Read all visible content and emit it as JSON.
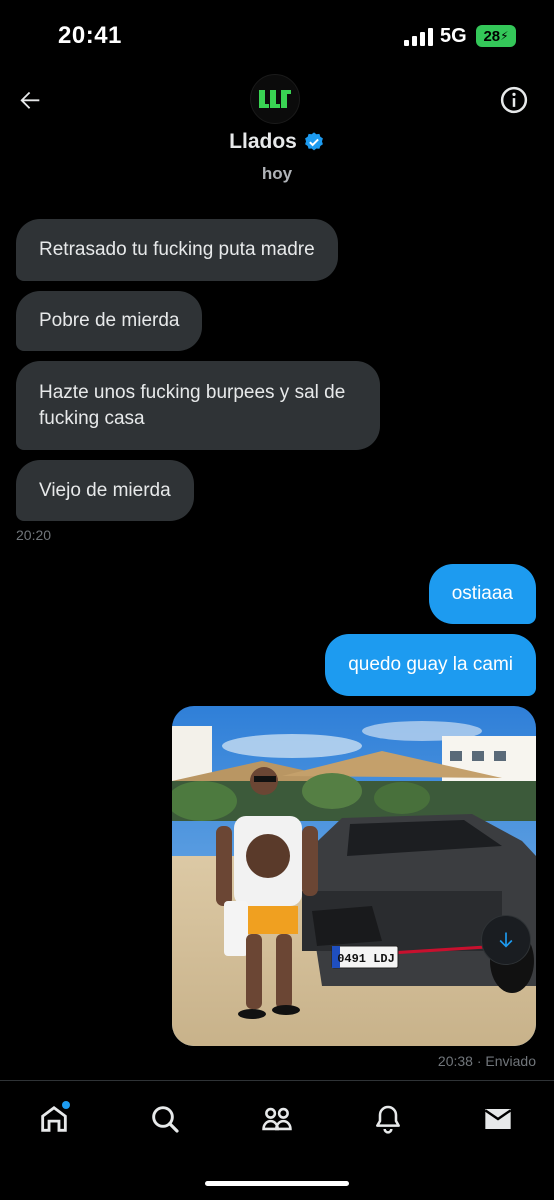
{
  "status_bar": {
    "time": "20:41",
    "network": "5G",
    "battery": "28"
  },
  "header": {
    "name": "Llados",
    "subtitle": "hoy",
    "avatar_text": "LLL"
  },
  "messages": {
    "incoming": [
      "Retrasado tu fucking puta madre",
      "Pobre de mierda",
      "Hazte unos fucking burpees y sal de fucking casa",
      "Viejo de mierda"
    ],
    "incoming_time": "20:20",
    "outgoing": [
      "ostiaaa",
      "quedo guay la cami"
    ],
    "photo_plate": "0491 LDJ",
    "outgoing_meta": "20:38 · Enviado"
  },
  "icons": {
    "back": "arrow-left-icon",
    "info": "info-icon",
    "verified": "verified-badge-icon",
    "scroll": "arrow-down-icon",
    "nav": [
      "home-icon",
      "search-icon",
      "communities-icon",
      "bell-icon",
      "mail-icon"
    ]
  },
  "colors": {
    "accent": "#1d9bf0",
    "incoming_bubble": "#2f3336",
    "background": "#000000",
    "battery": "#34c759"
  }
}
